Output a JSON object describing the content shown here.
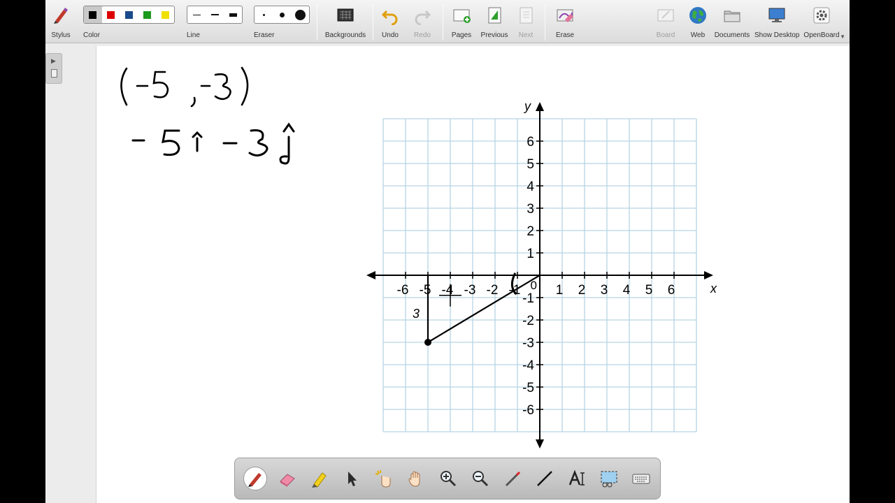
{
  "toolbar": {
    "stylus": "Stylus",
    "color": "Color",
    "line": "Line",
    "eraser": "Eraser",
    "backgrounds": "Backgrounds",
    "undo": "Undo",
    "redo": "Redo",
    "pages": "Pages",
    "previous": "Previous",
    "next": "Next",
    "erase": "Erase",
    "board": "Board",
    "web": "Web",
    "documents": "Documents",
    "show_desktop": "Show Desktop",
    "openboard": "OpenBoard"
  },
  "colors": {
    "palette": [
      "#000000",
      "#dd0000",
      "#1a4a8a",
      "#1c9a1c",
      "#f0e000"
    ],
    "selected_index": 0,
    "grid": "#b7d4e3",
    "ink": "#000000"
  },
  "handwriting": {
    "coordinate": "(-5 , -3)",
    "vector": "-5î  -3ĵ",
    "leg_label": "3"
  },
  "graph": {
    "y_label": "y",
    "x_label": "x",
    "origin_label": "0",
    "x_ticks": [
      "-6",
      "-5",
      "-4",
      "-3",
      "-2",
      "-1",
      "1",
      "2",
      "3",
      "4",
      "5",
      "6"
    ],
    "y_ticks": [
      "6",
      "5",
      "4",
      "3",
      "2",
      "1",
      "-1",
      "-2",
      "-3",
      "-4",
      "-5",
      "-6"
    ],
    "x_tick_values": [
      -6,
      -5,
      -4,
      -3,
      -2,
      -1,
      1,
      2,
      3,
      4,
      5,
      6
    ],
    "y_tick_values": [
      6,
      5,
      4,
      3,
      2,
      1,
      -1,
      -2,
      -3,
      -4,
      -5,
      -6
    ],
    "x_range": [
      -7,
      7
    ],
    "y_range": [
      -7,
      7
    ],
    "point": [
      -5,
      -3
    ],
    "segment_from": [
      0,
      0
    ],
    "segment_to": [
      -5,
      -3
    ],
    "leg_from": [
      -5,
      0
    ],
    "leg_to": [
      -5,
      -3
    ]
  },
  "dock": {
    "tools": [
      "pen-tool",
      "eraser-tool",
      "highlighter-tool",
      "selector-tool",
      "interactor-tool",
      "hand-tool",
      "zoom-in-tool",
      "zoom-out-tool",
      "laser-pointer-tool",
      "line-tool",
      "text-tool",
      "capture-tool",
      "keyboard-tool"
    ]
  }
}
